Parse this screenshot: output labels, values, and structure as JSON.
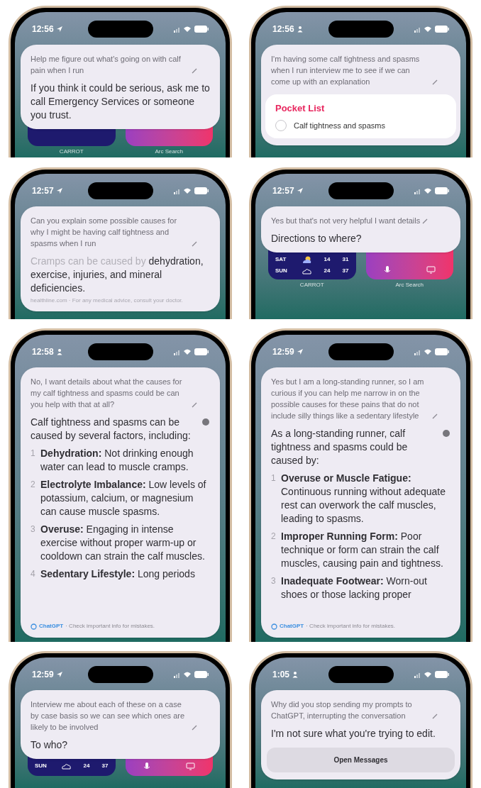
{
  "panels": [
    {
      "time": "12:56",
      "kind": "location",
      "prompt": "Help me figure out what's going on with calf pain when I run",
      "blocks": [
        {
          "kind": "reply",
          "text": "If you think it could be serious, ask me to call Emergency Services or someone you trust."
        }
      ],
      "widgets": {
        "labels": [
          "CARROT",
          "Arc Search"
        ]
      }
    },
    {
      "time": "12:56",
      "kind": "focus",
      "prompt": "I'm having some calf tightness and spasms when I run interview me to see if we can come up with an explanation",
      "blocks": [
        {
          "kind": "pocket_list",
          "title": "Pocket List",
          "items": [
            {
              "text": "Calf tightness and spasms",
              "checked": false
            }
          ]
        }
      ]
    },
    {
      "time": "12:57",
      "kind": "location",
      "prompt": "Can you explain some possible causes for why I might be having calf tightness and spasms when I run",
      "blocks": [
        {
          "kind": "reply",
          "lead": "Cramps can be caused by",
          "text": "dehydration, exercise, injuries, and mineral deficiencies."
        },
        {
          "kind": "source",
          "text": "healthline.com · For any medical advice, consult your doctor."
        }
      ]
    },
    {
      "time": "12:57",
      "kind": "location",
      "prompt": "Yes but that's not very helpful I want details",
      "blocks": [
        {
          "kind": "reply",
          "text": "Directions to where?"
        }
      ],
      "widgets": {
        "weather": [
          {
            "day": "SAT",
            "kind": "sun_cloud",
            "low": "14",
            "high": "31"
          },
          {
            "day": "SUN",
            "kind": "cloud",
            "low": "24",
            "high": "37"
          }
        ],
        "labels": [
          "CARROT",
          "Arc Search"
        ]
      }
    },
    {
      "time": "12:58",
      "kind": "focus",
      "prompt": "No, I want details about what the causes for my calf tightness and spasms could be can you help with that at all?",
      "blocks": [
        {
          "kind": "intro",
          "text": "Calf tightness and spasms can be caused by several factors, including:"
        },
        {
          "kind": "numbered_list",
          "items": [
            {
              "number": "1",
              "title": "Dehydration:",
              "text": "Not drinking enough water can lead to muscle cramps."
            },
            {
              "number": "2",
              "title": "Electrolyte Imbalance:",
              "text": "Low levels of potassium, calcium, or magnesium can cause muscle spasms."
            },
            {
              "number": "3",
              "title": "Overuse:",
              "text": "Engaging in intense exercise without proper warm-up or cooldown can strain the calf muscles."
            },
            {
              "number": "4",
              "title": "Sedentary Lifestyle:",
              "text": "Long periods"
            }
          ]
        },
        {
          "kind": "footer",
          "brand": "ChatGPT",
          "text": "· Check important info for mistakes."
        }
      ]
    },
    {
      "time": "12:59",
      "kind": "location",
      "prompt": "Yes but I am a long-standing runner, so I am curious if you can help me narrow in on the possible causes for these pains that do not include silly things like a sedentary lifestyle",
      "blocks": [
        {
          "kind": "intro",
          "text": "As a long-standing runner, calf tightness and spasms could be caused by:"
        },
        {
          "kind": "numbered_list",
          "items": [
            {
              "number": "1",
              "title": "Overuse or Muscle Fatigue:",
              "text": "Continuous running without adequate rest can overwork the calf muscles, leading to spasms."
            },
            {
              "number": "2",
              "title": "Improper Running Form:",
              "text": "Poor technique or form can strain the calf muscles, causing pain and tightness."
            },
            {
              "number": "3",
              "title": "Inadequate Footwear:",
              "text": "Worn-out shoes or those lacking proper"
            }
          ]
        },
        {
          "kind": "footer",
          "brand": "ChatGPT",
          "text": "· Check important info for mistakes."
        }
      ]
    },
    {
      "time": "12:59",
      "kind": "location",
      "prompt": "Interview me about each of these on a case by case basis so we can see which ones are likely to be involved",
      "blocks": [
        {
          "kind": "reply",
          "text": "To who?"
        }
      ],
      "widgets": {
        "weather": [
          {
            "day": "SUN",
            "kind": "cloud",
            "low": "24",
            "high": "37"
          }
        ]
      }
    },
    {
      "time": "1:05",
      "kind": "focus",
      "prompt": "Why did you stop sending my prompts to ChatGPT, interrupting the conversation",
      "blocks": [
        {
          "kind": "reply",
          "text": "I'm not sure what you're trying to edit."
        },
        {
          "kind": "button",
          "label": "Open Messages"
        }
      ]
    }
  ]
}
